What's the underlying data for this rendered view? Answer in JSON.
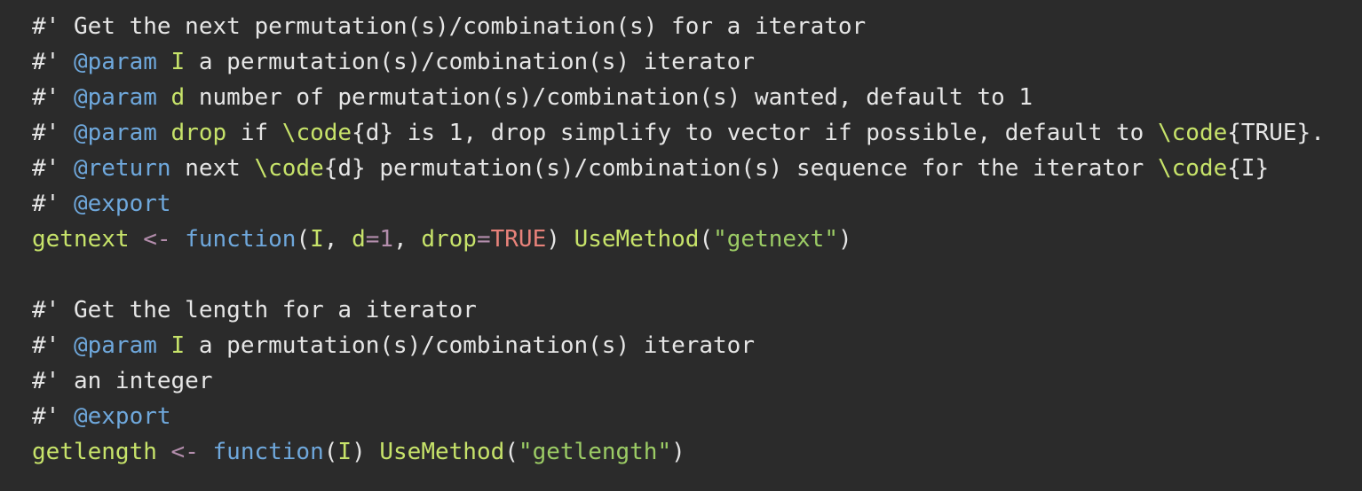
{
  "colors": {
    "background": "#2b2b2b",
    "text": "#e6e6e6",
    "roxygen_tag": "#6fa8dc",
    "identifier": "#c7e36a",
    "operator": "#b48ead",
    "keyword": "#6fa8dc",
    "constant": "#e8827a",
    "string": "#9ccc65"
  },
  "lines": [
    [
      {
        "cls": "t-comment",
        "text": "#' Get the next permutation(s)/combination(s) for a iterator"
      }
    ],
    [
      {
        "cls": "t-comment",
        "text": "#' "
      },
      {
        "cls": "t-tag",
        "text": "@param"
      },
      {
        "cls": "t-comment",
        "text": " "
      },
      {
        "cls": "t-param",
        "text": "I"
      },
      {
        "cls": "t-comment",
        "text": " a permutation(s)/combination(s) iterator"
      }
    ],
    [
      {
        "cls": "t-comment",
        "text": "#' "
      },
      {
        "cls": "t-tag",
        "text": "@param"
      },
      {
        "cls": "t-comment",
        "text": " "
      },
      {
        "cls": "t-param",
        "text": "d"
      },
      {
        "cls": "t-comment",
        "text": " number of permutation(s)/combination(s) wanted, default to 1"
      }
    ],
    [
      {
        "cls": "t-comment",
        "text": "#' "
      },
      {
        "cls": "t-tag",
        "text": "@param"
      },
      {
        "cls": "t-comment",
        "text": " "
      },
      {
        "cls": "t-param",
        "text": "drop"
      },
      {
        "cls": "t-comment",
        "text": " if "
      },
      {
        "cls": "t-latex",
        "text": "\\code"
      },
      {
        "cls": "t-brace",
        "text": "{d}"
      },
      {
        "cls": "t-comment",
        "text": " is 1, drop simplify to vector if possible, default to "
      },
      {
        "cls": "t-latex",
        "text": "\\code"
      },
      {
        "cls": "t-brace",
        "text": "{TRUE}"
      },
      {
        "cls": "t-comment",
        "text": "."
      }
    ],
    [
      {
        "cls": "t-comment",
        "text": "#' "
      },
      {
        "cls": "t-tag",
        "text": "@return"
      },
      {
        "cls": "t-comment",
        "text": " next "
      },
      {
        "cls": "t-latex",
        "text": "\\code"
      },
      {
        "cls": "t-brace",
        "text": "{d}"
      },
      {
        "cls": "t-comment",
        "text": " permutation(s)/combination(s) sequence for the iterator "
      },
      {
        "cls": "t-latex",
        "text": "\\code"
      },
      {
        "cls": "t-brace",
        "text": "{I}"
      }
    ],
    [
      {
        "cls": "t-comment",
        "text": "#' "
      },
      {
        "cls": "t-tag",
        "text": "@export"
      }
    ],
    [
      {
        "cls": "t-ident",
        "text": "getnext"
      },
      {
        "cls": "t-plain",
        "text": " "
      },
      {
        "cls": "t-assign",
        "text": "<-"
      },
      {
        "cls": "t-plain",
        "text": " "
      },
      {
        "cls": "t-kw",
        "text": "function"
      },
      {
        "cls": "t-punc",
        "text": "("
      },
      {
        "cls": "t-ident",
        "text": "I"
      },
      {
        "cls": "t-punc",
        "text": ", "
      },
      {
        "cls": "t-ident",
        "text": "d"
      },
      {
        "cls": "t-assign",
        "text": "="
      },
      {
        "cls": "t-num",
        "text": "1"
      },
      {
        "cls": "t-punc",
        "text": ", "
      },
      {
        "cls": "t-ident",
        "text": "drop"
      },
      {
        "cls": "t-assign",
        "text": "="
      },
      {
        "cls": "t-const",
        "text": "TRUE"
      },
      {
        "cls": "t-punc",
        "text": ") "
      },
      {
        "cls": "t-ident",
        "text": "UseMethod"
      },
      {
        "cls": "t-punc",
        "text": "("
      },
      {
        "cls": "t-str",
        "text": "\"getnext\""
      },
      {
        "cls": "t-punc",
        "text": ")"
      }
    ],
    [],
    [
      {
        "cls": "t-comment",
        "text": "#' Get the length for a iterator"
      }
    ],
    [
      {
        "cls": "t-comment",
        "text": "#' "
      },
      {
        "cls": "t-tag",
        "text": "@param"
      },
      {
        "cls": "t-comment",
        "text": " "
      },
      {
        "cls": "t-param",
        "text": "I"
      },
      {
        "cls": "t-comment",
        "text": " a permutation(s)/combination(s) iterator"
      }
    ],
    [
      {
        "cls": "t-comment",
        "text": "#' an integer"
      }
    ],
    [
      {
        "cls": "t-comment",
        "text": "#' "
      },
      {
        "cls": "t-tag",
        "text": "@export"
      }
    ],
    [
      {
        "cls": "t-ident",
        "text": "getlength"
      },
      {
        "cls": "t-plain",
        "text": " "
      },
      {
        "cls": "t-assign",
        "text": "<-"
      },
      {
        "cls": "t-plain",
        "text": " "
      },
      {
        "cls": "t-kw",
        "text": "function"
      },
      {
        "cls": "t-punc",
        "text": "("
      },
      {
        "cls": "t-ident",
        "text": "I"
      },
      {
        "cls": "t-punc",
        "text": ") "
      },
      {
        "cls": "t-ident",
        "text": "UseMethod"
      },
      {
        "cls": "t-punc",
        "text": "("
      },
      {
        "cls": "t-str",
        "text": "\"getlength\""
      },
      {
        "cls": "t-punc",
        "text": ")"
      }
    ]
  ]
}
